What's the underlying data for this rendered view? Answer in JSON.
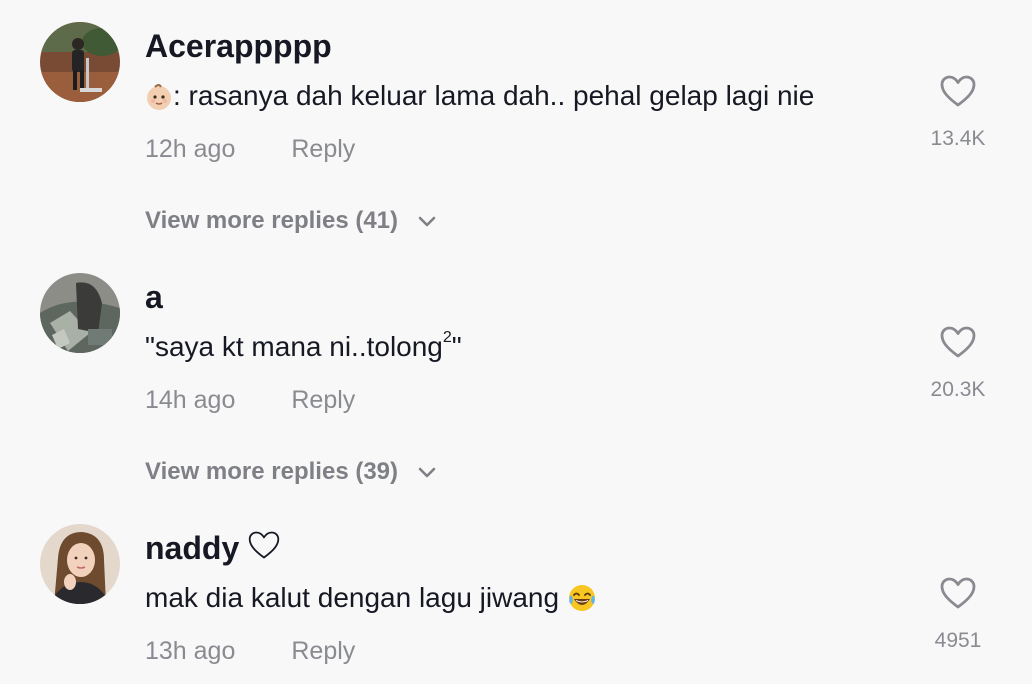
{
  "comments": [
    {
      "username": "Acerappppp",
      "text_prefix": ": rasanya dah keluar lama dah.. pehal gelap lagi nie",
      "leading_emoji": "baby-face-emoji",
      "time": "12h ago",
      "reply_label": "Reply",
      "like_count": "13.4K",
      "view_more": "View more replies (41)"
    },
    {
      "username": "a",
      "text_before_sup": "\"saya kt mana ni..tolong",
      "text_sup": "2",
      "text_after_sup": "\"",
      "time": "14h ago",
      "reply_label": "Reply",
      "like_count": "20.3K",
      "view_more": "View more replies (39)"
    },
    {
      "username": "naddy",
      "username_suffix_icon": "heart-outline-icon",
      "text": "mak dia kalut dengan lagu jiwang",
      "trailing_emoji": "tears-of-joy-emoji",
      "time": "13h ago",
      "reply_label": "Reply",
      "like_count": "4951"
    }
  ],
  "colors": {
    "background": "#f8f8f8",
    "primary_text": "#161823",
    "secondary_text": "#8a8b91"
  }
}
